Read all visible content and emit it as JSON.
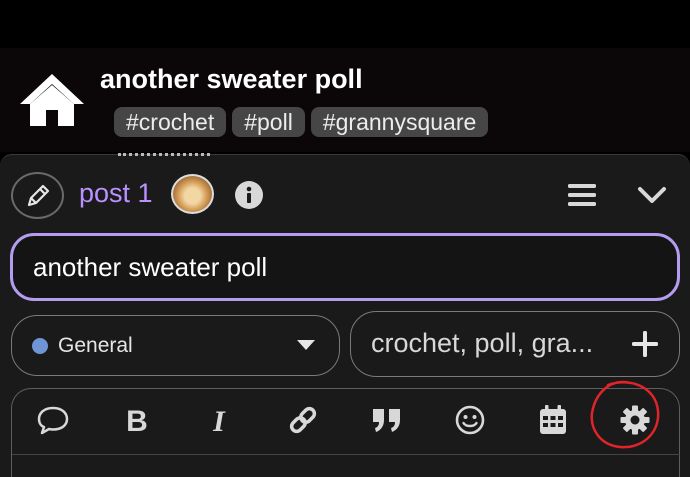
{
  "topic": {
    "title": "another sweater poll",
    "tags": [
      "#crochet",
      "#poll",
      "#grannysquare"
    ]
  },
  "composer": {
    "post_label": "post 1",
    "title_value": "another sweater poll",
    "category": {
      "label": "General",
      "color": "#6f95d6"
    },
    "tag_chooser_text": "crochet, poll, gra..."
  },
  "toolbar": {
    "buttons": [
      "speech-bubble-icon",
      "bold-icon",
      "italic-icon",
      "link-icon",
      "quote-icon",
      "emoji-icon",
      "calendar-icon",
      "gear-icon"
    ]
  },
  "colors": {
    "accent": "#b892ff",
    "input_border": "#b59cf0",
    "annotation": "#e0242a",
    "header_bg": "#0b0607",
    "composer_bg": "#1a1a1a"
  }
}
